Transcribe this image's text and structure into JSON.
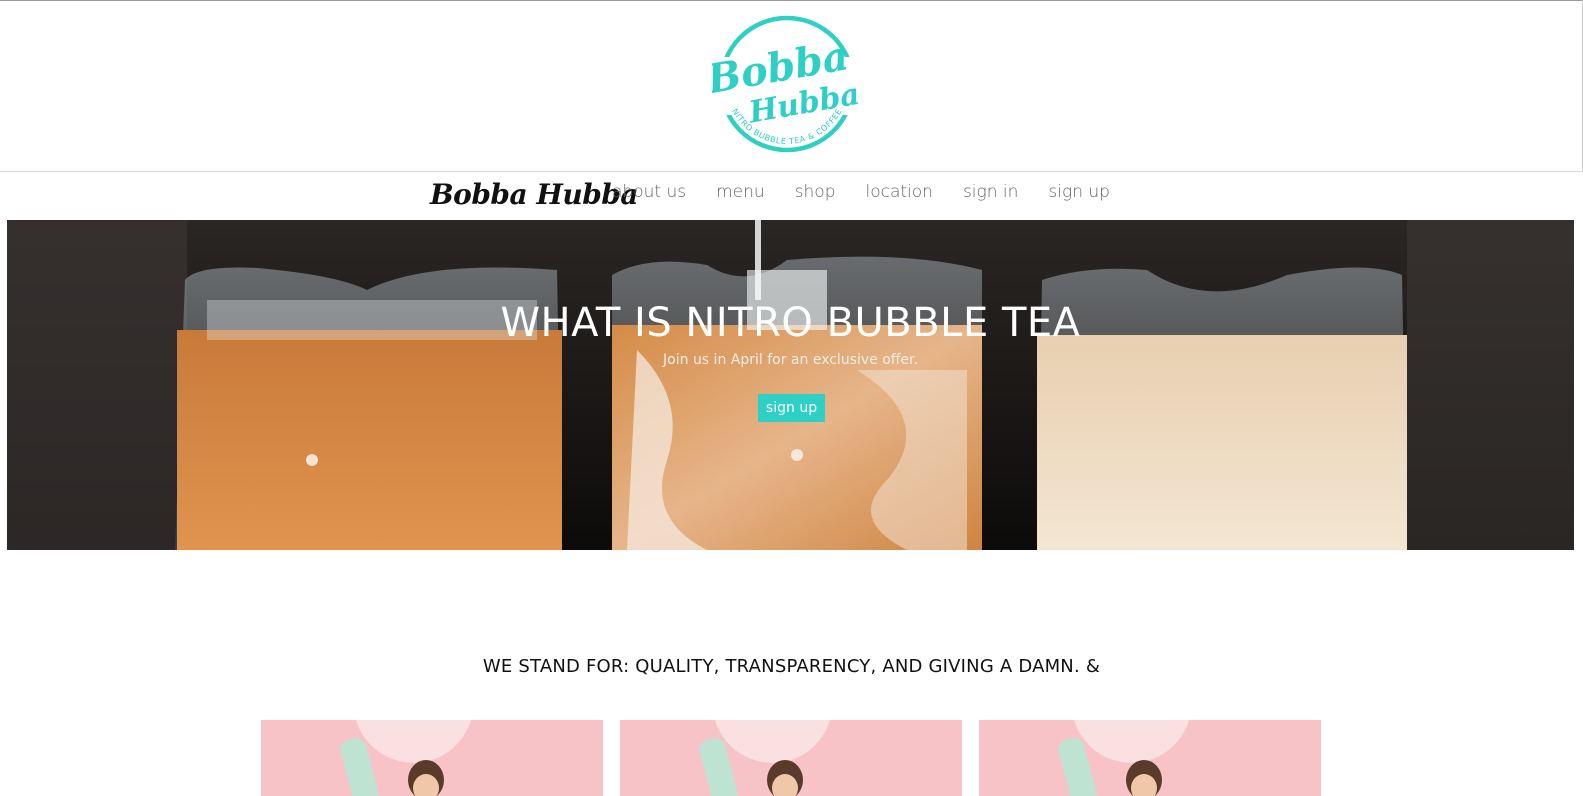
{
  "logo": {
    "line1": "Bobba",
    "line2": "Hubba",
    "tagline": "NITRO BUBBLE TEA & COFFEE",
    "color": "#2ecfc4"
  },
  "nav": {
    "brand": "Bobba Hubba",
    "items": [
      "about us",
      "menu",
      "shop",
      "location",
      "sign in",
      "sign up"
    ]
  },
  "hero": {
    "title": "WHAT IS NITRO BUBBLE TEA",
    "subtitle": "Join us in April for an exclusive offer.",
    "button_label": "sign up"
  },
  "values_heading": "WE STAND FOR: QUALITY, TRANSPARENCY, AND GIVING A DAMN. &",
  "colors": {
    "accent": "#2ecfc4",
    "card_bg": "#f7c3c6",
    "nav_text": "#666666"
  }
}
